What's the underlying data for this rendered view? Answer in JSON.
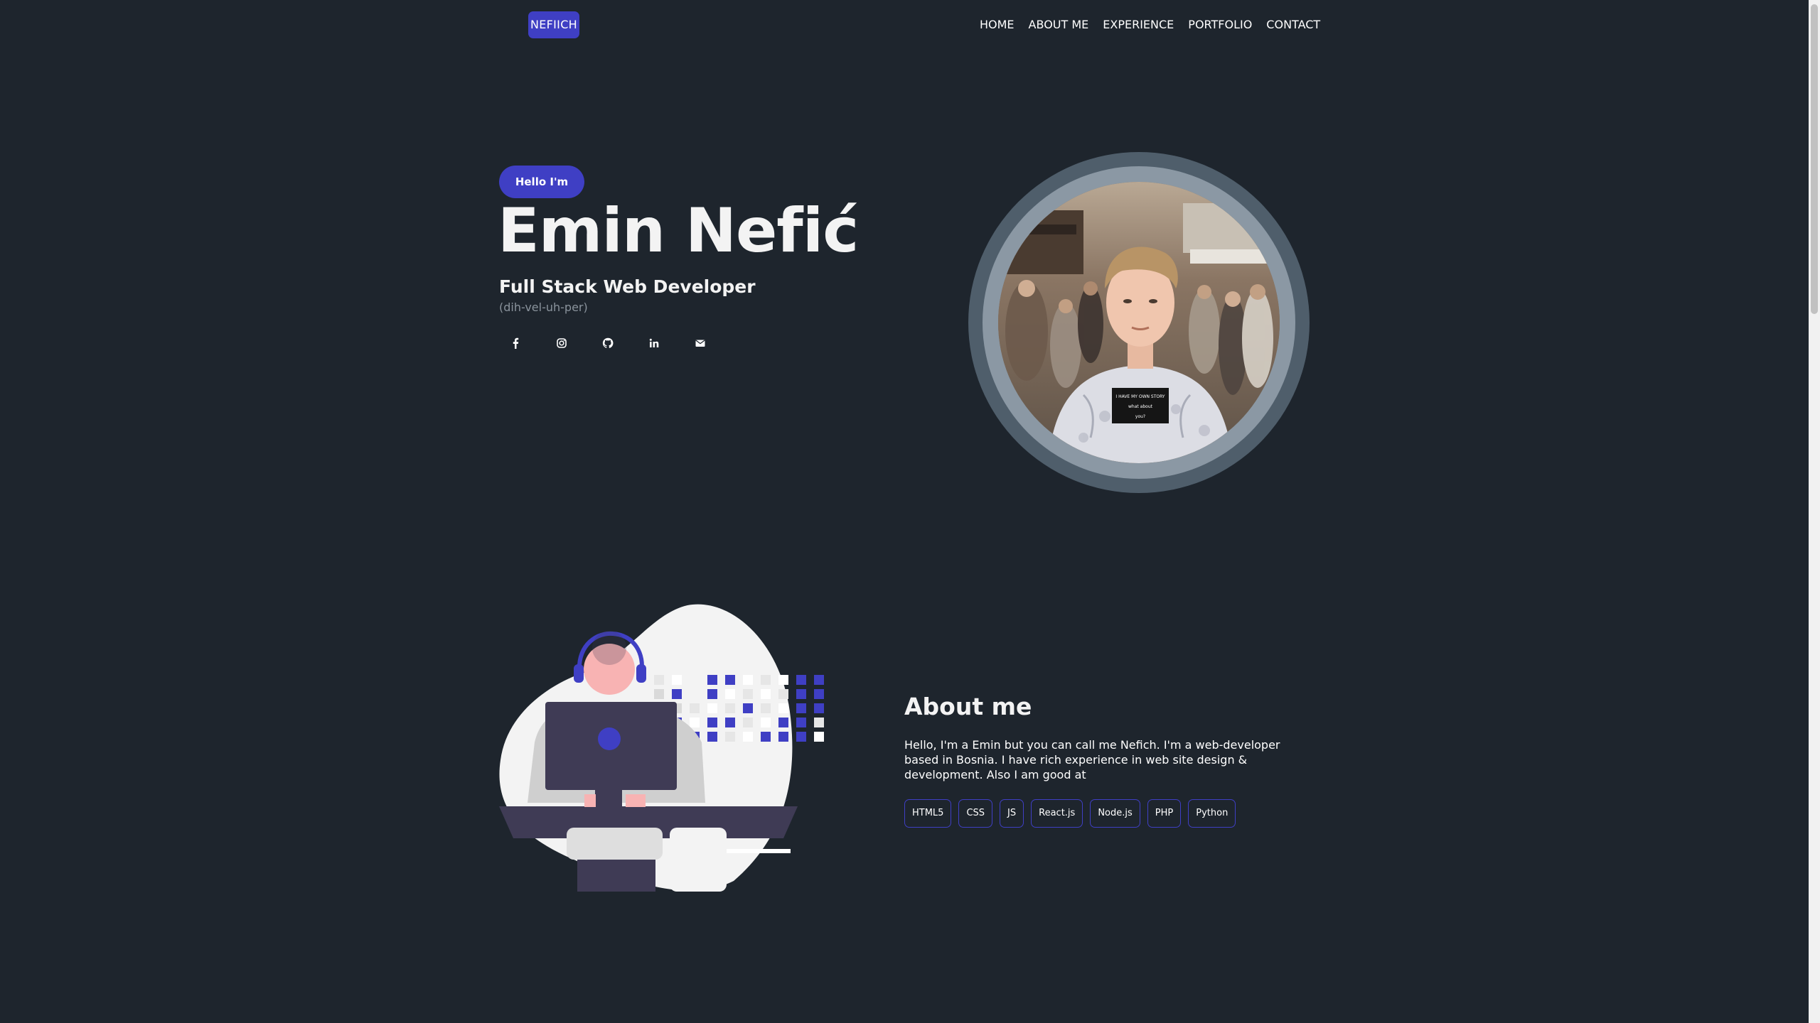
{
  "nav": {
    "logo": "NEFIICH",
    "items": [
      {
        "label": "HOME"
      },
      {
        "label": "ABOUT ME"
      },
      {
        "label": "EXPERIENCE"
      },
      {
        "label": "PORTFOLIO"
      },
      {
        "label": "CONTACT"
      }
    ]
  },
  "hero": {
    "badge": "Hello I'm",
    "name": "Emin Nefić",
    "role": "Full Stack Web Developer",
    "phonetic": "(dih-vel-uh-per)",
    "socials": [
      {
        "icon": "facebook-icon"
      },
      {
        "icon": "instagram-icon"
      },
      {
        "icon": "github-icon"
      },
      {
        "icon": "linkedin-icon"
      },
      {
        "icon": "email-icon"
      }
    ],
    "shirt_text": [
      "I HAVE MY OWN STORY",
      "what about",
      "you?"
    ]
  },
  "about": {
    "title": "About me",
    "text": "Hello, I'm a Emin but you can call me Nefich. I'm a web-developer based in Bosnia. I have rich experience in web site design & development. Also I am good at",
    "skills": [
      "HTML5",
      "CSS",
      "JS",
      "React.js",
      "Node.js",
      "PHP",
      "Python"
    ]
  },
  "colors": {
    "background": "#1e252d",
    "accent": "#3f3fc4",
    "text": "#ffffff",
    "muted": "#8a939c"
  }
}
